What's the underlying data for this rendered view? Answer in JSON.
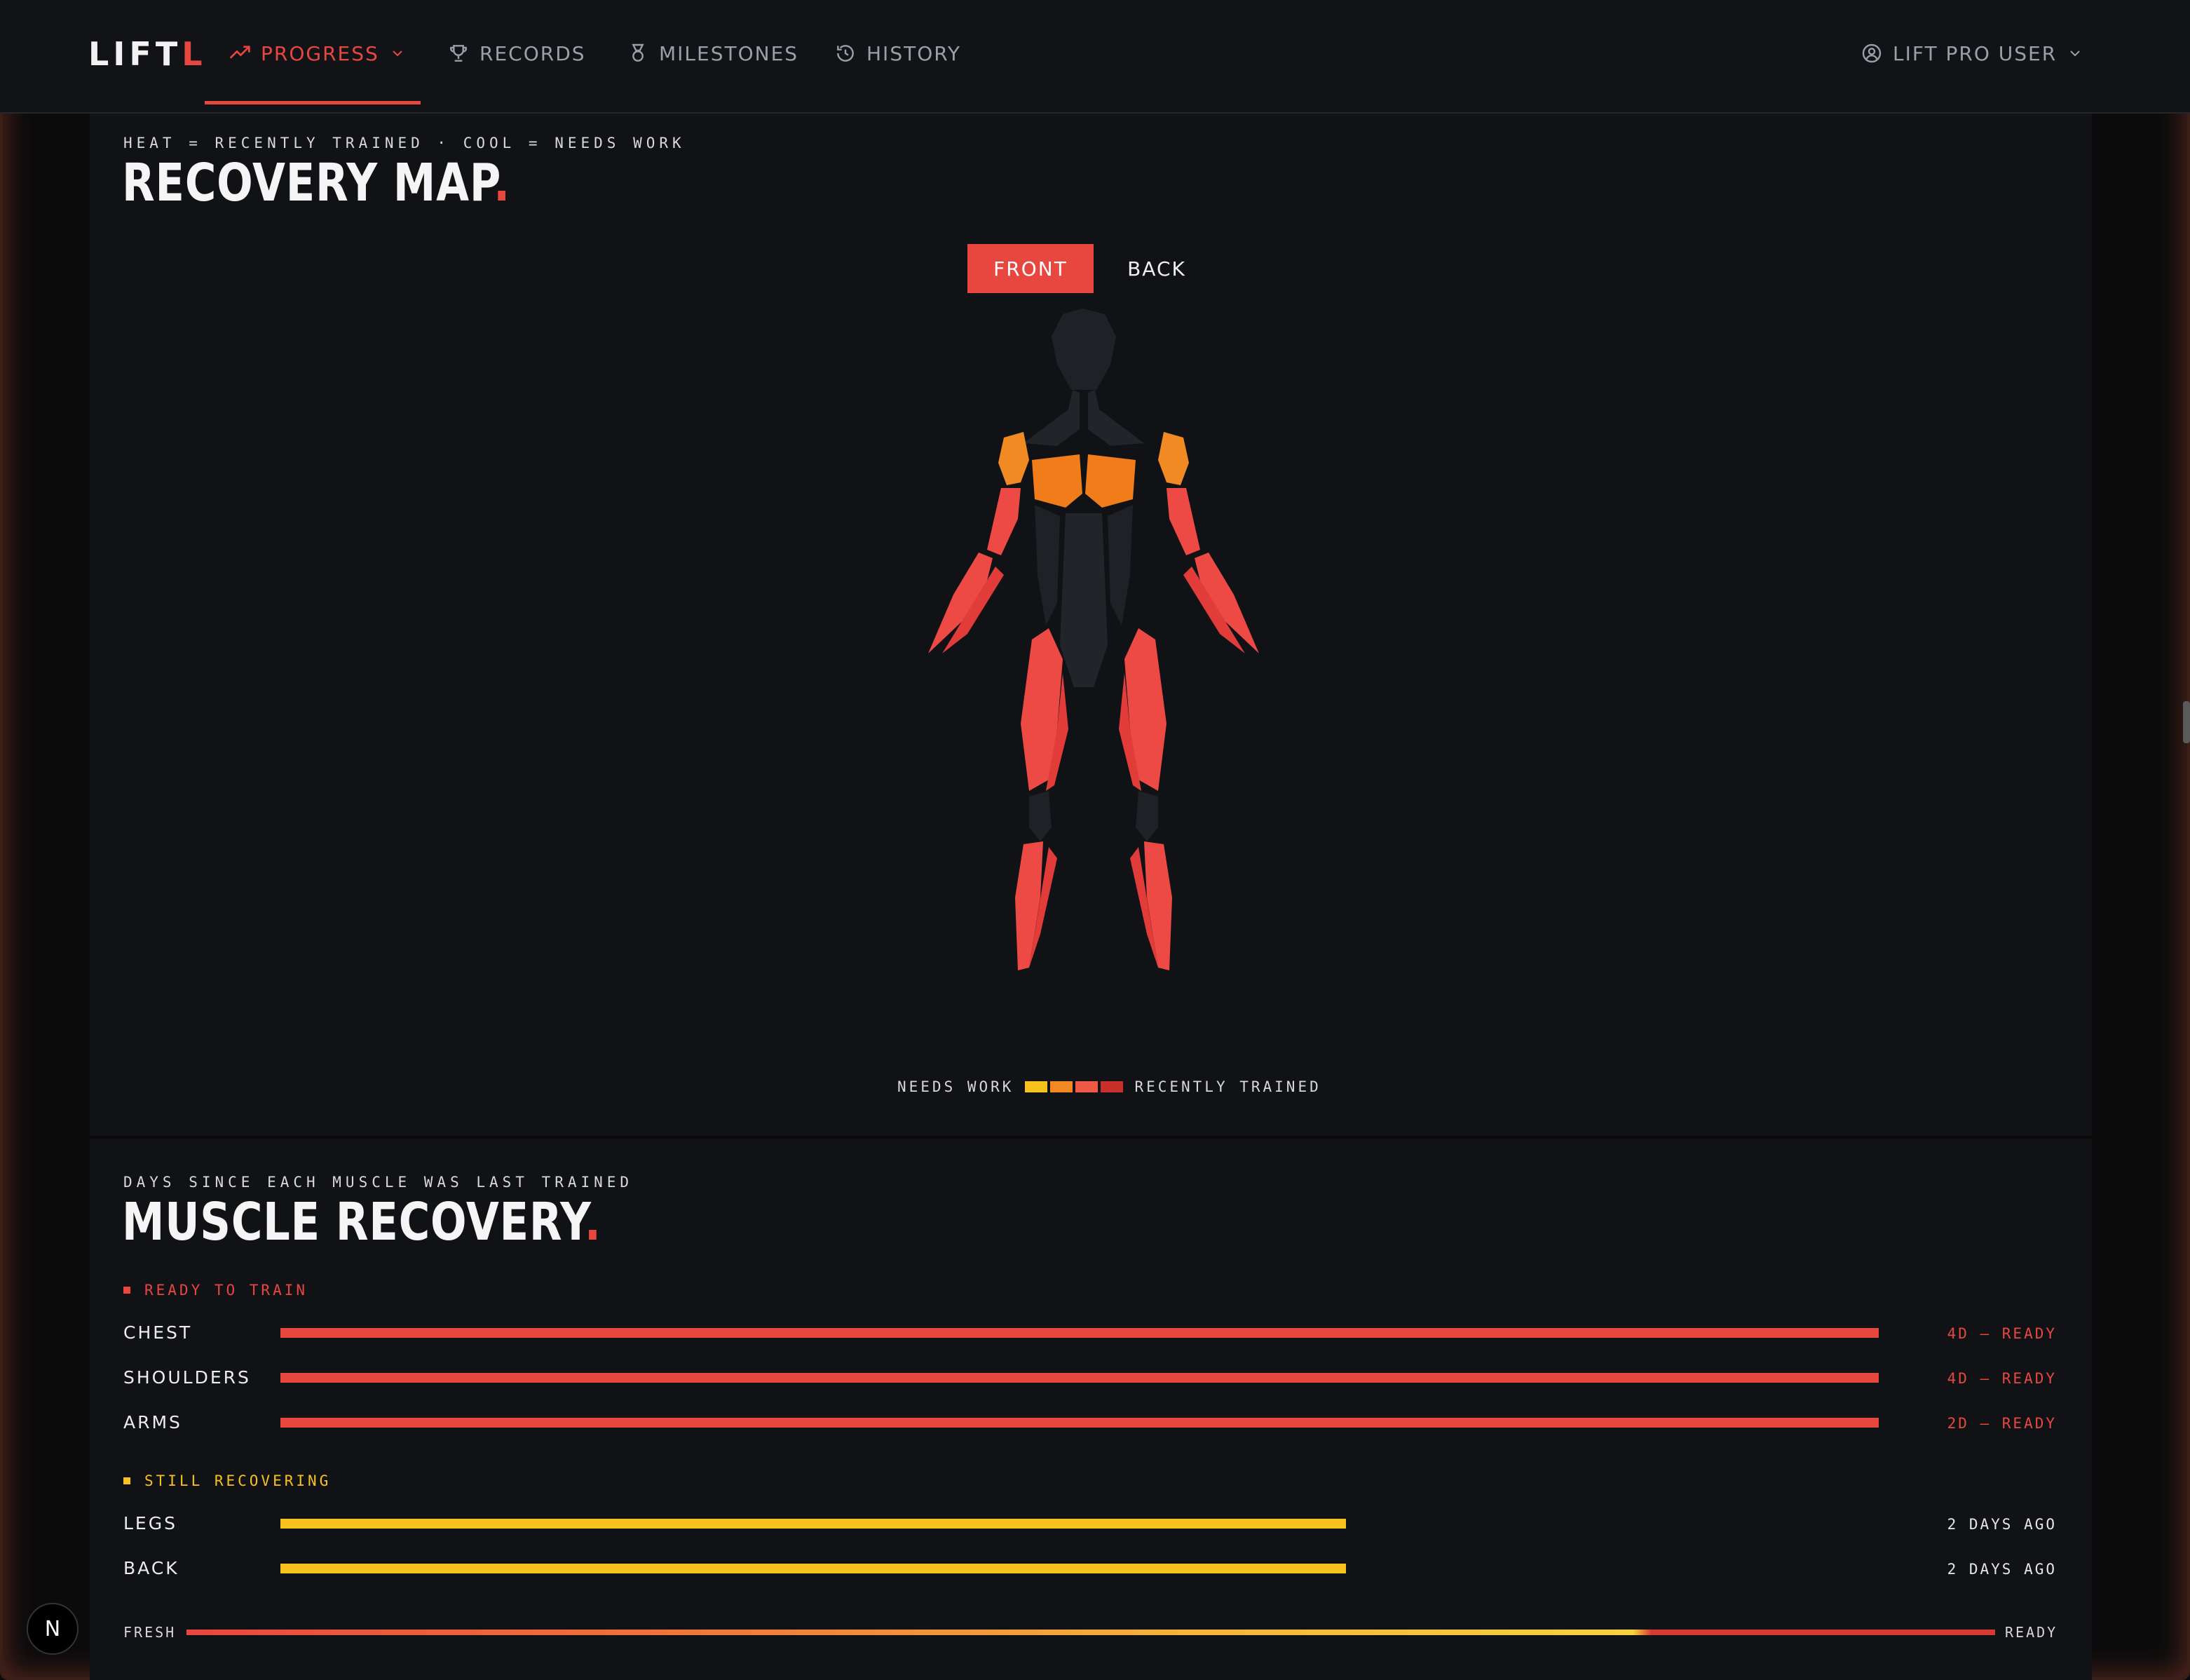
{
  "brand": {
    "text": "LIFT",
    "accent": "L"
  },
  "nav": {
    "items": [
      {
        "label": "PROGRESS",
        "icon": "trending-up-icon",
        "active": true
      },
      {
        "label": "RECORDS",
        "icon": "trophy-icon"
      },
      {
        "label": "MILESTONES",
        "icon": "medal-icon"
      },
      {
        "label": "HISTORY",
        "icon": "history-icon"
      }
    ],
    "user": {
      "label": "LIFT PRO USER",
      "icon": "user-circle-icon"
    }
  },
  "recovery_map": {
    "eyebrow": "HEAT = RECENTLY TRAINED · COOL = NEEDS WORK",
    "title": "RECOVERY MAP",
    "title_dot": ".",
    "view_front": "FRONT",
    "view_back": "BACK",
    "legend_left": "NEEDS WORK",
    "legend_right": "RECENTLY TRAINED",
    "legend_colors": [
      "#f7c21e",
      "#f28a23",
      "#ee5a44",
      "#c9302c"
    ]
  },
  "muscle_recovery": {
    "eyebrow": "DAYS SINCE EACH MUSCLE WAS LAST TRAINED",
    "title": "MUSCLE RECOVERY",
    "title_dot": ".",
    "groups": [
      {
        "label": "READY TO TRAIN",
        "color": "#e8473f",
        "rows": [
          {
            "name": "CHEST",
            "status": "4D — READY",
            "fill": 1.0
          },
          {
            "name": "SHOULDERS",
            "status": "4D — READY",
            "fill": 1.0
          },
          {
            "name": "ARMS",
            "status": "2D — READY",
            "fill": 1.0
          }
        ]
      },
      {
        "label": "STILL RECOVERING",
        "color": "#f7c21e",
        "rows": [
          {
            "name": "LEGS",
            "status": "2 DAYS AGO",
            "fill": 0.667
          },
          {
            "name": "BACK",
            "status": "2 DAYS AGO",
            "fill": 0.667
          }
        ]
      }
    ],
    "scale_left": "FRESH",
    "scale_right": "READY"
  },
  "badge": {
    "text": "N"
  },
  "colors": {
    "accent": "#e8473f",
    "warm": "#f28a23",
    "muscle_hot": "#ee4a45",
    "body_base": "#1f2126"
  }
}
